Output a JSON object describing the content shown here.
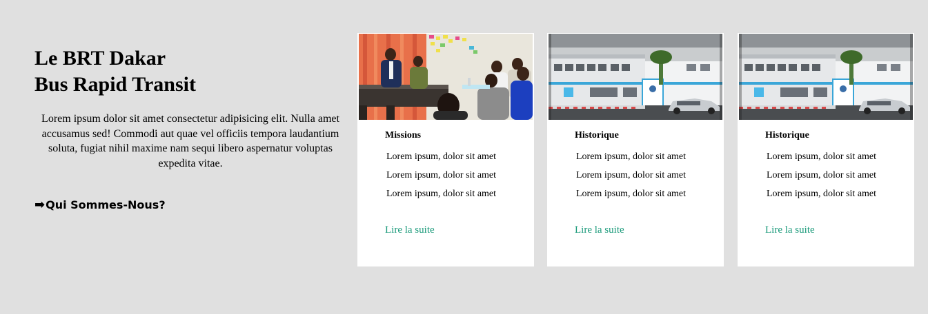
{
  "intro": {
    "title_line1": "Le BRT Dakar",
    "title_line2": "Bus Rapid Transit",
    "text": "Lorem ipsum dolor sit amet consectetur adipisicing elit. Nulla amet accusamus sed! Commodi aut quae vel officiis tempora laudantium soluta, fugiat nihil maxime nam sequi libero aspernatur voluptas expedita vitae.",
    "cta_arrow": "➡",
    "cta_label": "Qui Sommes-Nous?"
  },
  "cards": [
    {
      "title": "Missions",
      "items": [
        "Lorem ipsum, dolor sit amet",
        "Lorem ipsum, dolor sit amet",
        "Lorem ipsum, dolor sit amet"
      ],
      "link": "Lire la suite"
    },
    {
      "title": "Historique",
      "items": [
        "Lorem ipsum, dolor sit amet",
        "Lorem ipsum, dolor sit amet",
        "Lorem ipsum, dolor sit amet"
      ],
      "link": "Lire la suite"
    },
    {
      "title": "Historique",
      "items": [
        "Lorem ipsum, dolor sit amet",
        "Lorem ipsum, dolor sit amet",
        "Lorem ipsum, dolor sit amet"
      ],
      "link": "Lire la suite"
    }
  ],
  "colors": {
    "page_background": "#e0e0e0",
    "card_background": "#ffffff",
    "link": "#1a9a7a"
  }
}
